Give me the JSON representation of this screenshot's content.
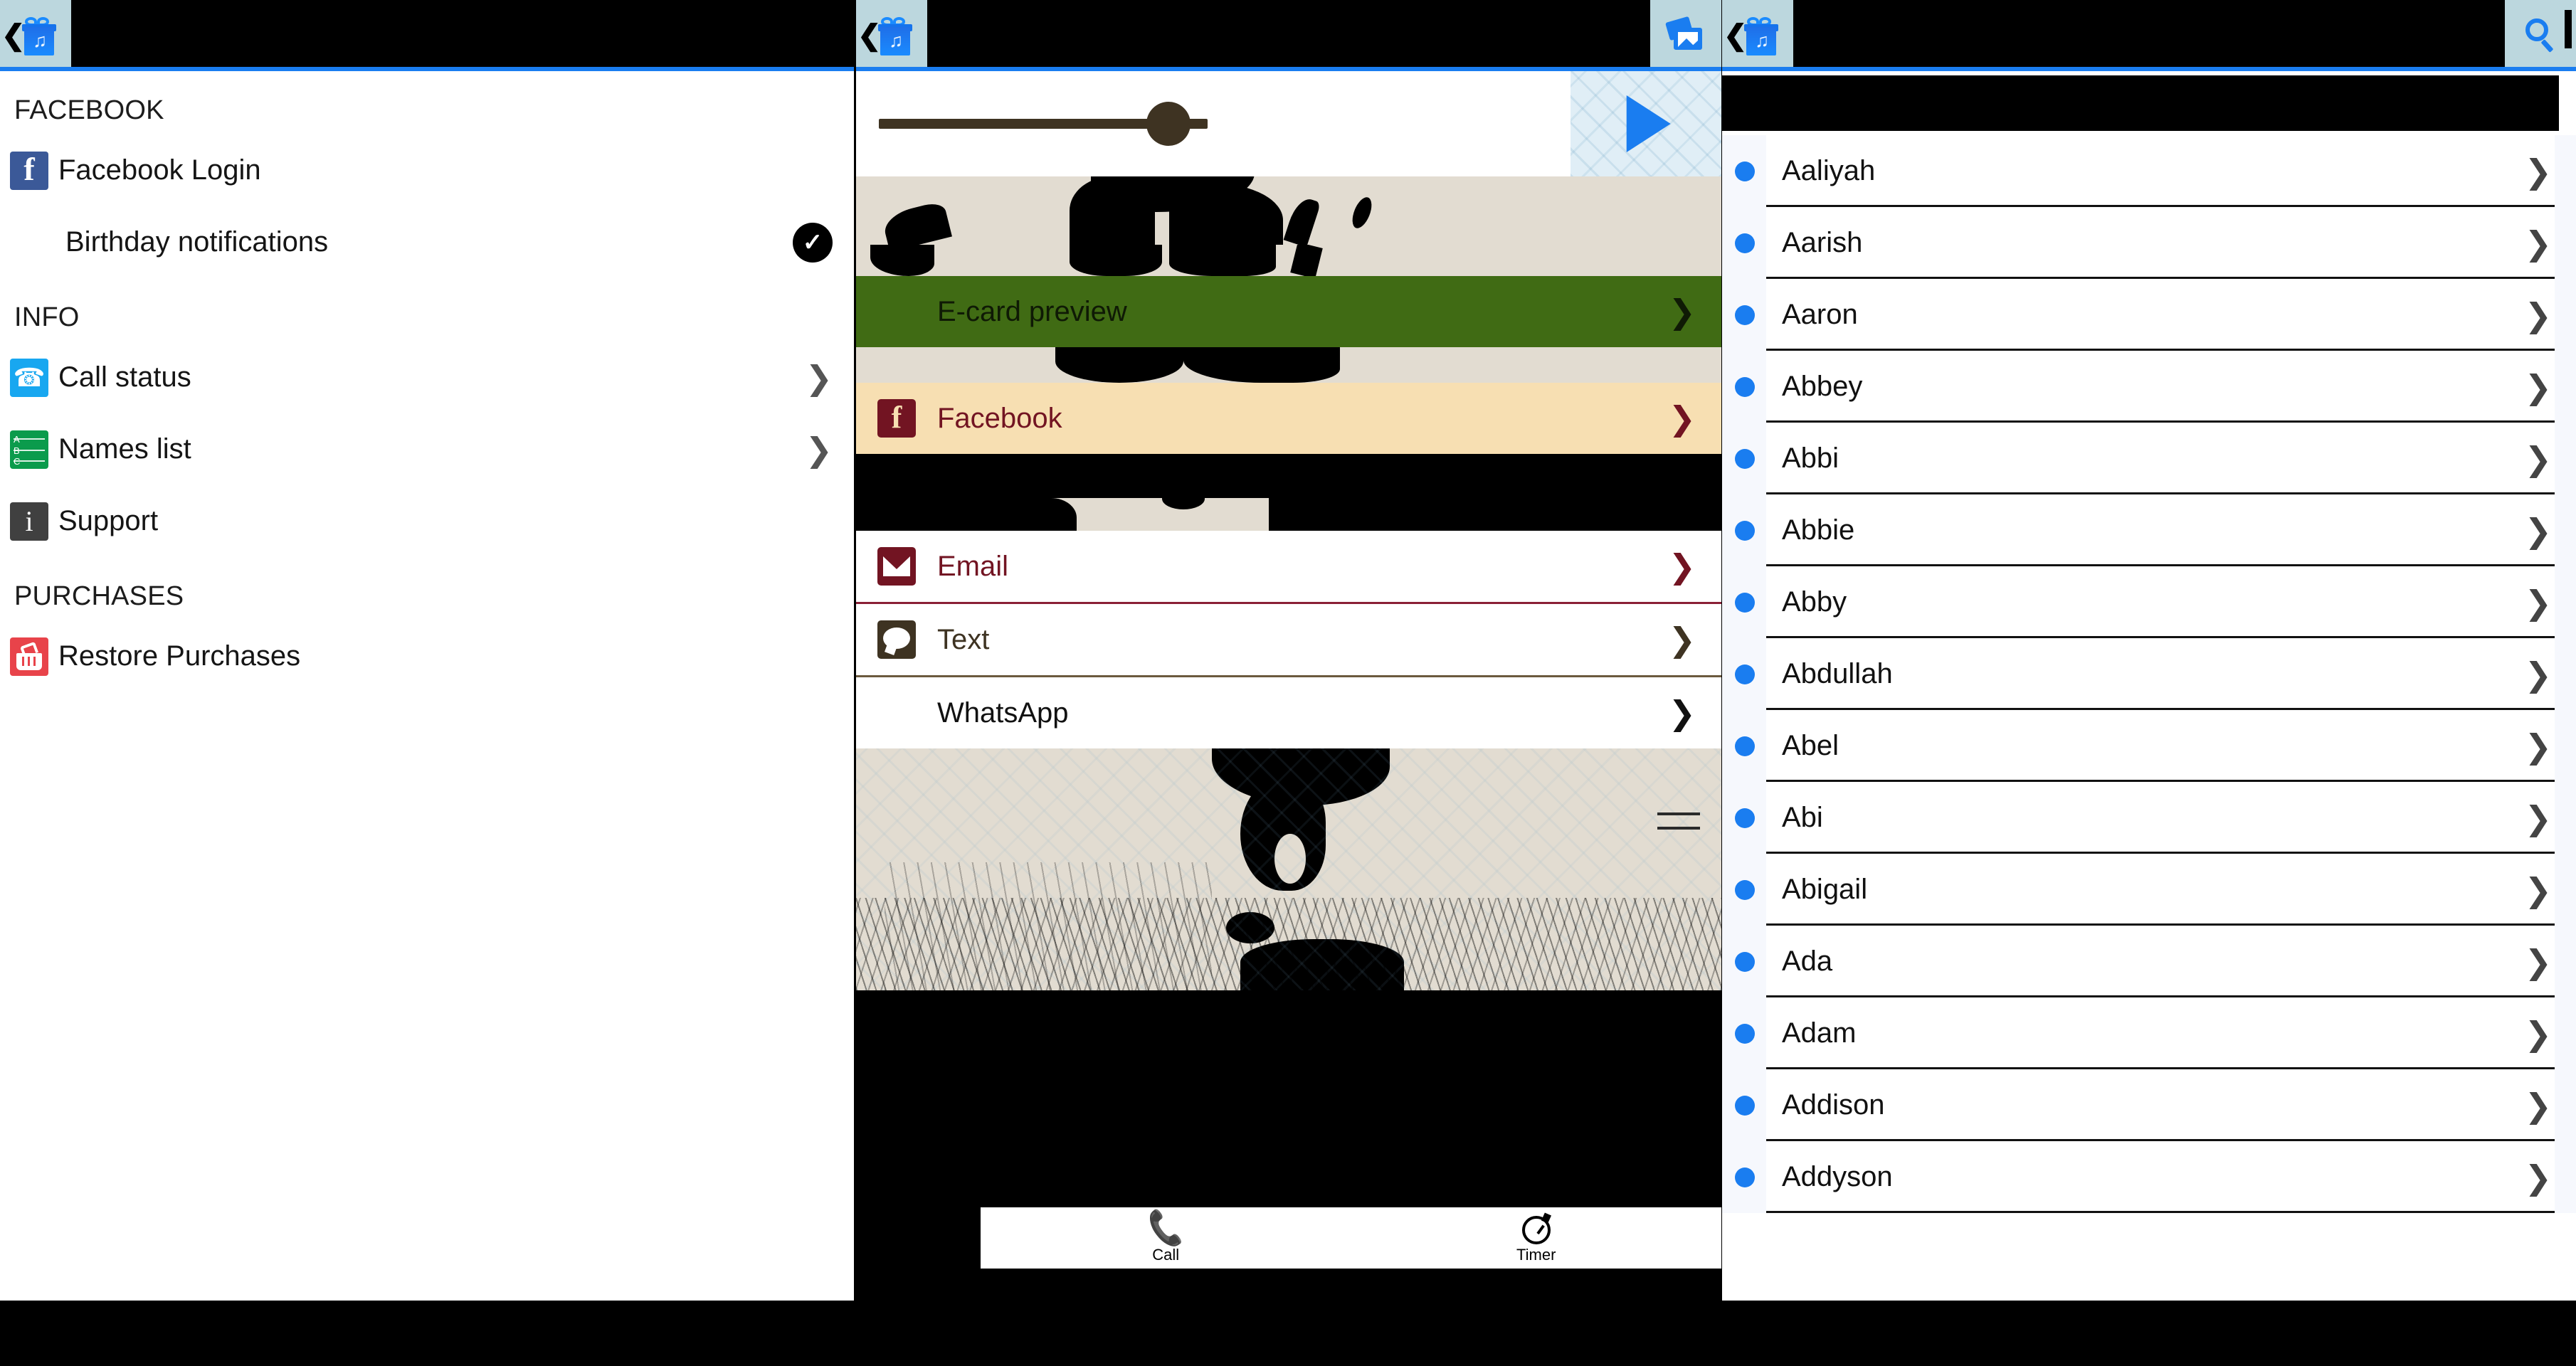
{
  "colors": {
    "header_bg": "#000000",
    "header_button_bg": "#bcd7de",
    "accent_blue": "#1a7df0",
    "ecard_green": "#406b14",
    "facebook_tan": "#f7dfb2",
    "facebook_maroon": "#721422",
    "text_brown": "#3e3322",
    "art_beige": "#e2dcd1",
    "facebook_blue": "#3b5998"
  },
  "left_panel": {
    "header": {
      "back_icon": "gift-music-back-icon",
      "title": ""
    },
    "sections": [
      {
        "title": "FACEBOOK",
        "items": [
          {
            "label": "Facebook Login",
            "icon": "facebook-icon",
            "accessory": "none",
            "indent": false
          },
          {
            "label": "Birthday notifications",
            "icon": "none",
            "accessory": "check",
            "indent": true
          }
        ]
      },
      {
        "title": "INFO",
        "items": [
          {
            "label": "Call status",
            "icon": "phone-icon",
            "accessory": "chevron",
            "indent": false
          },
          {
            "label": "Names list",
            "icon": "abc-list-icon",
            "accessory": "chevron",
            "indent": false
          },
          {
            "label": "Support",
            "icon": "info-icon",
            "accessory": "none",
            "indent": false
          }
        ]
      },
      {
        "title": "PURCHASES",
        "items": [
          {
            "label": "Restore Purchases",
            "icon": "cart-icon",
            "accessory": "none",
            "indent": false
          }
        ]
      }
    ]
  },
  "mid_panel": {
    "header": {
      "back_icon": "gift-music-back-icon",
      "title": "",
      "action_icon": "cards-icon"
    },
    "player": {
      "seek_value_pct": 88,
      "play_icon": "play-icon"
    },
    "rows": [
      {
        "label": "E-card preview",
        "icon": "none",
        "style": "ecard"
      },
      {
        "label": "Facebook",
        "icon": "facebook-icon",
        "style": "facebook"
      },
      {
        "label": "Email",
        "icon": "mail-icon",
        "style": "email"
      },
      {
        "label": "Text",
        "icon": "chat-bubble-icon",
        "style": "text"
      },
      {
        "label": "WhatsApp",
        "icon": "none",
        "style": "whatsapp"
      }
    ],
    "tabs": [
      {
        "label": "Call",
        "icon": "phone-icon"
      },
      {
        "label": "Timer",
        "icon": "timer-icon"
      }
    ]
  },
  "right_panel": {
    "header": {
      "back_icon": "gift-music-back-icon",
      "title": "",
      "action_icon": "search-icon"
    },
    "search": {
      "value": "",
      "placeholder": ""
    },
    "names": [
      "Aaliyah",
      "Aarish",
      "Aaron",
      "Abbey",
      "Abbi",
      "Abbie",
      "Abby",
      "Abdullah",
      "Abel",
      "Abi",
      "Abigail",
      "Ada",
      "Adam",
      "Addison",
      "Addyson"
    ]
  }
}
